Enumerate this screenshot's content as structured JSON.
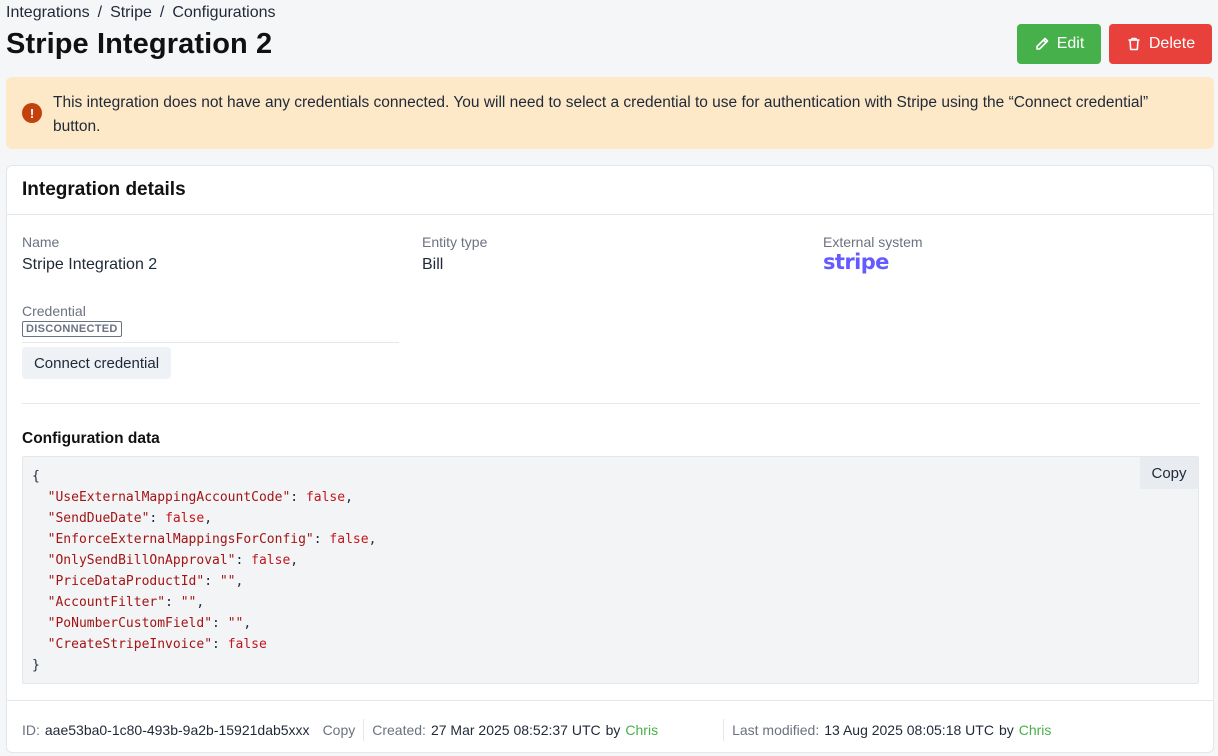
{
  "breadcrumb": {
    "items": [
      "Integrations",
      "Stripe",
      "Configurations"
    ],
    "separator": "/"
  },
  "page_title": "Stripe Integration 2",
  "actions": {
    "edit_label": "Edit",
    "delete_label": "Delete"
  },
  "alert": {
    "icon": "exclamation-icon",
    "text": "This integration does not have any credentials connected. You will need to select a credential to use for authentication with Stripe using the “Connect credential” button."
  },
  "details": {
    "title": "Integration details",
    "name_label": "Name",
    "name_value": "Stripe Integration 2",
    "entity_type_label": "Entity type",
    "entity_type_value": "Bill",
    "external_system_label": "External system",
    "external_system_logo": "stripe",
    "credential_label": "Credential",
    "credential_status": "DISCONNECTED",
    "connect_button": "Connect credential"
  },
  "config": {
    "title": "Configuration data",
    "copy_label": "Copy",
    "entries": [
      {
        "key": "\"UseExternalMappingAccountCode\"",
        "value": "false",
        "type": "bool"
      },
      {
        "key": "\"SendDueDate\"",
        "value": "false",
        "type": "bool"
      },
      {
        "key": "\"EnforceExternalMappingsForConfig\"",
        "value": "false",
        "type": "bool"
      },
      {
        "key": "\"OnlySendBillOnApproval\"",
        "value": "false",
        "type": "bool"
      },
      {
        "key": "\"PriceDataProductId\"",
        "value": "\"\"",
        "type": "string"
      },
      {
        "key": "\"AccountFilter\"",
        "value": "\"\"",
        "type": "string"
      },
      {
        "key": "\"PoNumberCustomField\"",
        "value": "\"\"",
        "type": "string"
      },
      {
        "key": "\"CreateStripeInvoice\"",
        "value": "false",
        "type": "bool"
      }
    ]
  },
  "footer": {
    "id_label": "ID:",
    "id_value": "aae53ba0-1c80-493b-9a2b-15921dab5xxx",
    "copy_label": "Copy",
    "created_label": "Created:",
    "created_value": "27 Mar 2025 08:52:37 UTC",
    "created_by": "by",
    "created_user": "Chris",
    "modified_label": "Last modified:",
    "modified_value": "13 Aug 2025 08:05:18 UTC",
    "modified_by": "by",
    "modified_user": "Chris"
  },
  "colors": {
    "edit": "#46b14a",
    "delete": "#e8413c",
    "alert_bg": "#fde8c8",
    "stripe": "#635bff",
    "user_link": "#46b14a"
  }
}
